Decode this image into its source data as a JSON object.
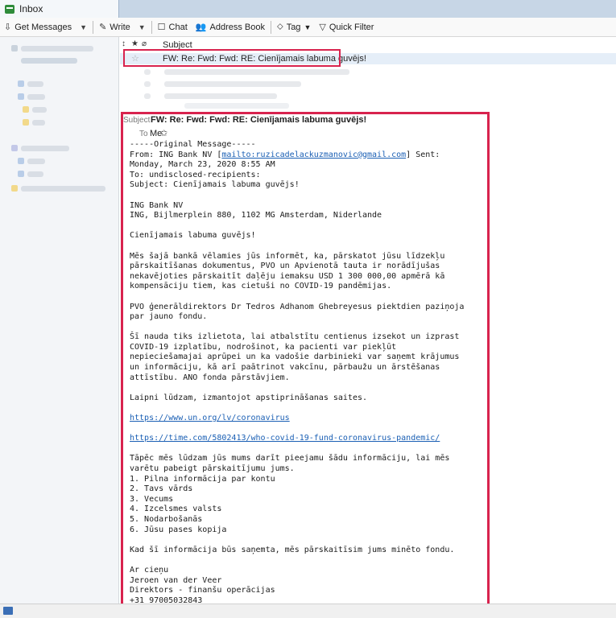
{
  "tab": {
    "title": "Inbox"
  },
  "toolbar": {
    "get_messages": "Get Messages",
    "write": "Write",
    "chat": "Chat",
    "address_book": "Address Book",
    "tag": "Tag",
    "quick_filter": "Quick Filter"
  },
  "thread": {
    "subject_header": "Subject",
    "selected_subject": "FW: Re: Fwd: Fwd: RE: Cienījamais labuma guvējs!"
  },
  "message": {
    "subject_label": "Subject",
    "subject": "FW: Re: Fwd: Fwd: RE: Cienījamais labuma guvējs!",
    "to_label": "To",
    "to": "Me",
    "body": {
      "p1": "-----Original Message-----\nFrom: ING Bank NV [",
      "mailto_link": "mailto:ruzicadelackuzmanovic@gmail.com",
      "p2": "] Sent:\nMonday, March 23, 2020 8:55 AM\nTo: undisclosed-recipients:\nSubject: Cienījamais labuma guvējs!\n\nING Bank NV\nING, Bijlmerplein 880, 1102 MG Amsterdam, Niderlande\n\nCienījamais labuma guvējs!\n\nMēs šajā bankā vēlamies jūs informēt, ka, pārskatot jūsu līdzekļu\npārskaitīšanas dokumentus, PVO un Apvienotā tauta ir norādījušas\nnekavējoties pārskaitīt daļēju iemaksu USD 1 300 000,00 apmērā kā\nkompensāciju tiem, kas cietuši no COVID-19 pandēmijas.\n\nPVO ģenerāldirektors Dr Tedros Adhanom Ghebreyesus piektdien paziņoja\npar jauno fondu.\n\nŠī nauda tiks izlietota, lai atbalstītu centienus izsekot un izprast\nCOVID-19 izplatību, nodrošinot, ka pacienti var piekļūt\nnepieciešamajai aprūpei un ka vadošie darbinieki var saņemt krājumus\nun informāciju, kā arī paātrinot vakcīnu, pārbaužu un ārstēšanas\nattīstību. ANO fonda pārstāvjiem.\n\nLaipni lūdzam, izmantojot apstiprināšanas saites.\n\n",
      "link1": "https://www.un.org/lv/coronavirus",
      "p3": "\n\n",
      "link2": "https://time.com/5802413/who-covid-19-fund-coronavirus-pandemic/",
      "p4": "\n\nTāpēc mēs lūdzam jūs mums darīt pieejamu šādu informāciju, lai mēs\nvarētu pabeigt pārskaitījumu jums.\n1. Pilna informācija par kontu\n2. Tavs vārds\n3. Vecums\n4. Izcelsmes valsts\n5. Nodarbošanās\n6. Jūsu pases kopija\n\nKad šī informācija būs saņemta, mēs pārskaitīsim jums minēto fondu.\n\nAr cieņu\nJeroen van der Veer\nDirektors - finanšu operācijas\n+31 97005032843"
    }
  },
  "colors": {
    "highlight": "#d8234e",
    "link": "#1a5fb4",
    "selected_row": "#e5eef8"
  }
}
